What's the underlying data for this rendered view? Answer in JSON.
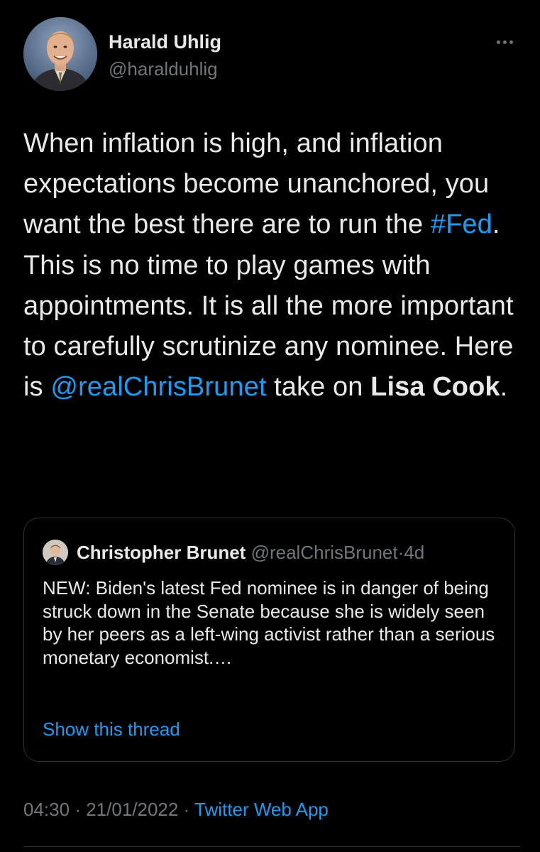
{
  "colors": {
    "background": "#000000",
    "text_primary": "#e7e9ea",
    "text_secondary": "#71767b",
    "accent_link": "#1d9bf0",
    "border": "#2f3336"
  },
  "author": {
    "name": "Harald Uhlig",
    "handle": "@haralduhlig",
    "avatar_icon": "profile-photo"
  },
  "more_menu_icon": "more-horizontal-icon",
  "tweet": {
    "segments": [
      {
        "type": "text",
        "text": "When inflation is high, and inflation expectations become unanchored, you want the best there are to run the "
      },
      {
        "type": "hashtag",
        "text": "#Fed"
      },
      {
        "type": "text",
        "text": ".  This is no time to play games with appointments.  It is all the more important to carefully scrutinize any nominee.  Here is "
      },
      {
        "type": "mention",
        "text": "@realChrisBrunet"
      },
      {
        "type": "text",
        "text": " take on "
      },
      {
        "type": "bold",
        "text": "Lisa Cook"
      },
      {
        "type": "text",
        "text": "."
      }
    ]
  },
  "quote": {
    "author_name": "Christopher Brunet",
    "author_handle": "@realChrisBrunet",
    "separator": "·",
    "time": "4d",
    "text": "NEW: Biden's latest Fed nominee is in danger of being struck down in the Senate because she is widely seen by her peers as a left-wing activist rather than a serious monetary economist.…",
    "show_thread": "Show this thread"
  },
  "meta": {
    "time": "04:30",
    "sep1": "·",
    "date": "21/01/2022",
    "sep2": "·",
    "source": "Twitter Web App"
  }
}
